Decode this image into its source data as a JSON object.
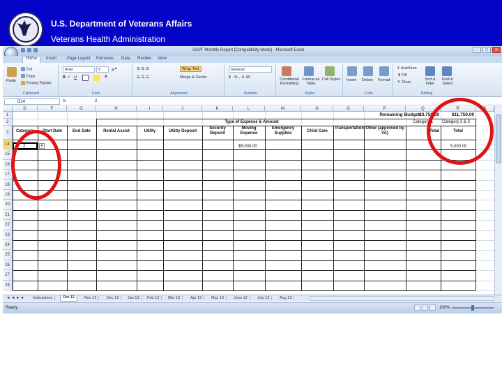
{
  "banner": {
    "title": "U.S. Department of Veterans Affairs",
    "subtitle": "Veterans Health Administration",
    "seal_icon": "va-seal-icon",
    "background": "#0404c8"
  },
  "window": {
    "title": "SSVF Monthly Report [Compatibility Mode] - Microsoft Excel"
  },
  "ribbon": {
    "tabs": [
      "Home",
      "Insert",
      "Page Layout",
      "Formulas",
      "Data",
      "Review",
      "View"
    ],
    "clipboard": {
      "paste": "Paste",
      "cut": "Cut",
      "copy": "Copy",
      "format_painter": "Format Painter",
      "label": "Clipboard"
    },
    "font": {
      "name": "Arial",
      "size": "9",
      "label": "Font"
    },
    "alignment": {
      "wrap": "Wrap Text",
      "merge": "Merge & Center",
      "label": "Alignment"
    },
    "number": {
      "format": "General",
      "label": "Number"
    },
    "styles": {
      "conditional": "Conditional Formatting",
      "format_table": "Format as Table",
      "cell_styles": "Cell Styles",
      "label": "Styles"
    },
    "cells": {
      "insert": "Insert",
      "delete": "Delete",
      "format": "Format",
      "label": "Cells"
    },
    "editing": {
      "autosum": "AutoSum",
      "fill": "Fill",
      "clear": "Clear",
      "sort": "Sort & Filter",
      "find": "Find & Select",
      "label": "Editing"
    }
  },
  "formula_bar": {
    "name_box": "D14",
    "fx": "fx",
    "value": "2"
  },
  "columns": [
    "D",
    "F",
    "G",
    "H",
    "I",
    "J",
    "K",
    "L",
    "M",
    "N",
    "O",
    "P",
    "Q",
    "R",
    "S"
  ],
  "rows": [
    "1",
    "2",
    "3",
    "14",
    "15",
    "16",
    "17",
    "18",
    "19",
    "20",
    "21",
    "22",
    "23",
    "24",
    "25",
    "26",
    "27",
    "28"
  ],
  "sheet": {
    "remaining_budget": "Remaining Budget:",
    "budget_p": "$3,750.00",
    "budget_r": "$11,750.00",
    "cat_p": "Category 1",
    "cat_r": "Category 2 & 3",
    "type_header": "Type of Expense & Amount",
    "headers": [
      "Category",
      "Start Date",
      "End Date",
      "Rental Assist",
      "Utility",
      "Utility Deposit",
      "Security Deposit",
      "Moving Expense",
      "Emergency Supplies",
      "Child Care",
      "Transportation",
      "Other (approved by VA)",
      "Total",
      "Total"
    ],
    "cell_d14": "2",
    "moving_val": "$5,000.00",
    "total_val": "5,000.00"
  },
  "sheet_tabs": [
    "Instructions",
    "Oct 12",
    "Nov 12",
    "Dec 12",
    "Jan 13",
    "Feb 13",
    "Mar 13",
    "Apr 13",
    "May 13",
    "June 13",
    "July 13",
    "Aug 13"
  ],
  "status": {
    "ready": "Ready",
    "zoom": "100%"
  },
  "annotation_color": "#e11212"
}
